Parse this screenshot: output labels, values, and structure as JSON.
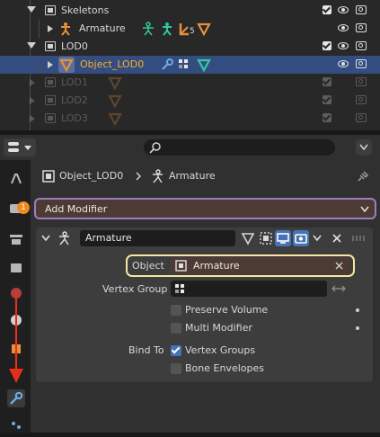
{
  "outliner": {
    "rows": [
      {
        "label": "Skeletons"
      },
      {
        "label": "Armature",
        "modifier_count": "5"
      },
      {
        "label": "LOD0"
      },
      {
        "label": "Object_LOD0"
      },
      {
        "label": "LOD1"
      },
      {
        "label": "LOD2"
      },
      {
        "label": "LOD3"
      }
    ]
  },
  "header": {
    "search_placeholder": ""
  },
  "breadcrumb": {
    "object": "Object_LOD0",
    "data": "Armature"
  },
  "add_modifier_label": "Add Modifier",
  "add_modifier_badge": "1",
  "modifier": {
    "name": "Armature",
    "object_label": "Object",
    "object_value": "Armature",
    "vertex_group_label": "Vertex Group",
    "vertex_group_value": "",
    "preserve_volume_label": "Preserve Volume",
    "preserve_volume": false,
    "multi_modifier_label": "Multi Modifier",
    "multi_modifier": false,
    "bind_to_label": "Bind To",
    "vertex_groups_label": "Vertex Groups",
    "vertex_groups": true,
    "bone_envelopes_label": "Bone Envelopes",
    "bone_envelopes": false
  },
  "colors": {
    "selected_row": "#334d80",
    "object_text": "#ffaf29",
    "highlight_outline": "#f5e6a0",
    "add_modifier_outline": "#9a7ec4",
    "arrow": "#e52e1e",
    "mesh_icon": "#e8913a",
    "armature_icon": "#32c8a0"
  }
}
